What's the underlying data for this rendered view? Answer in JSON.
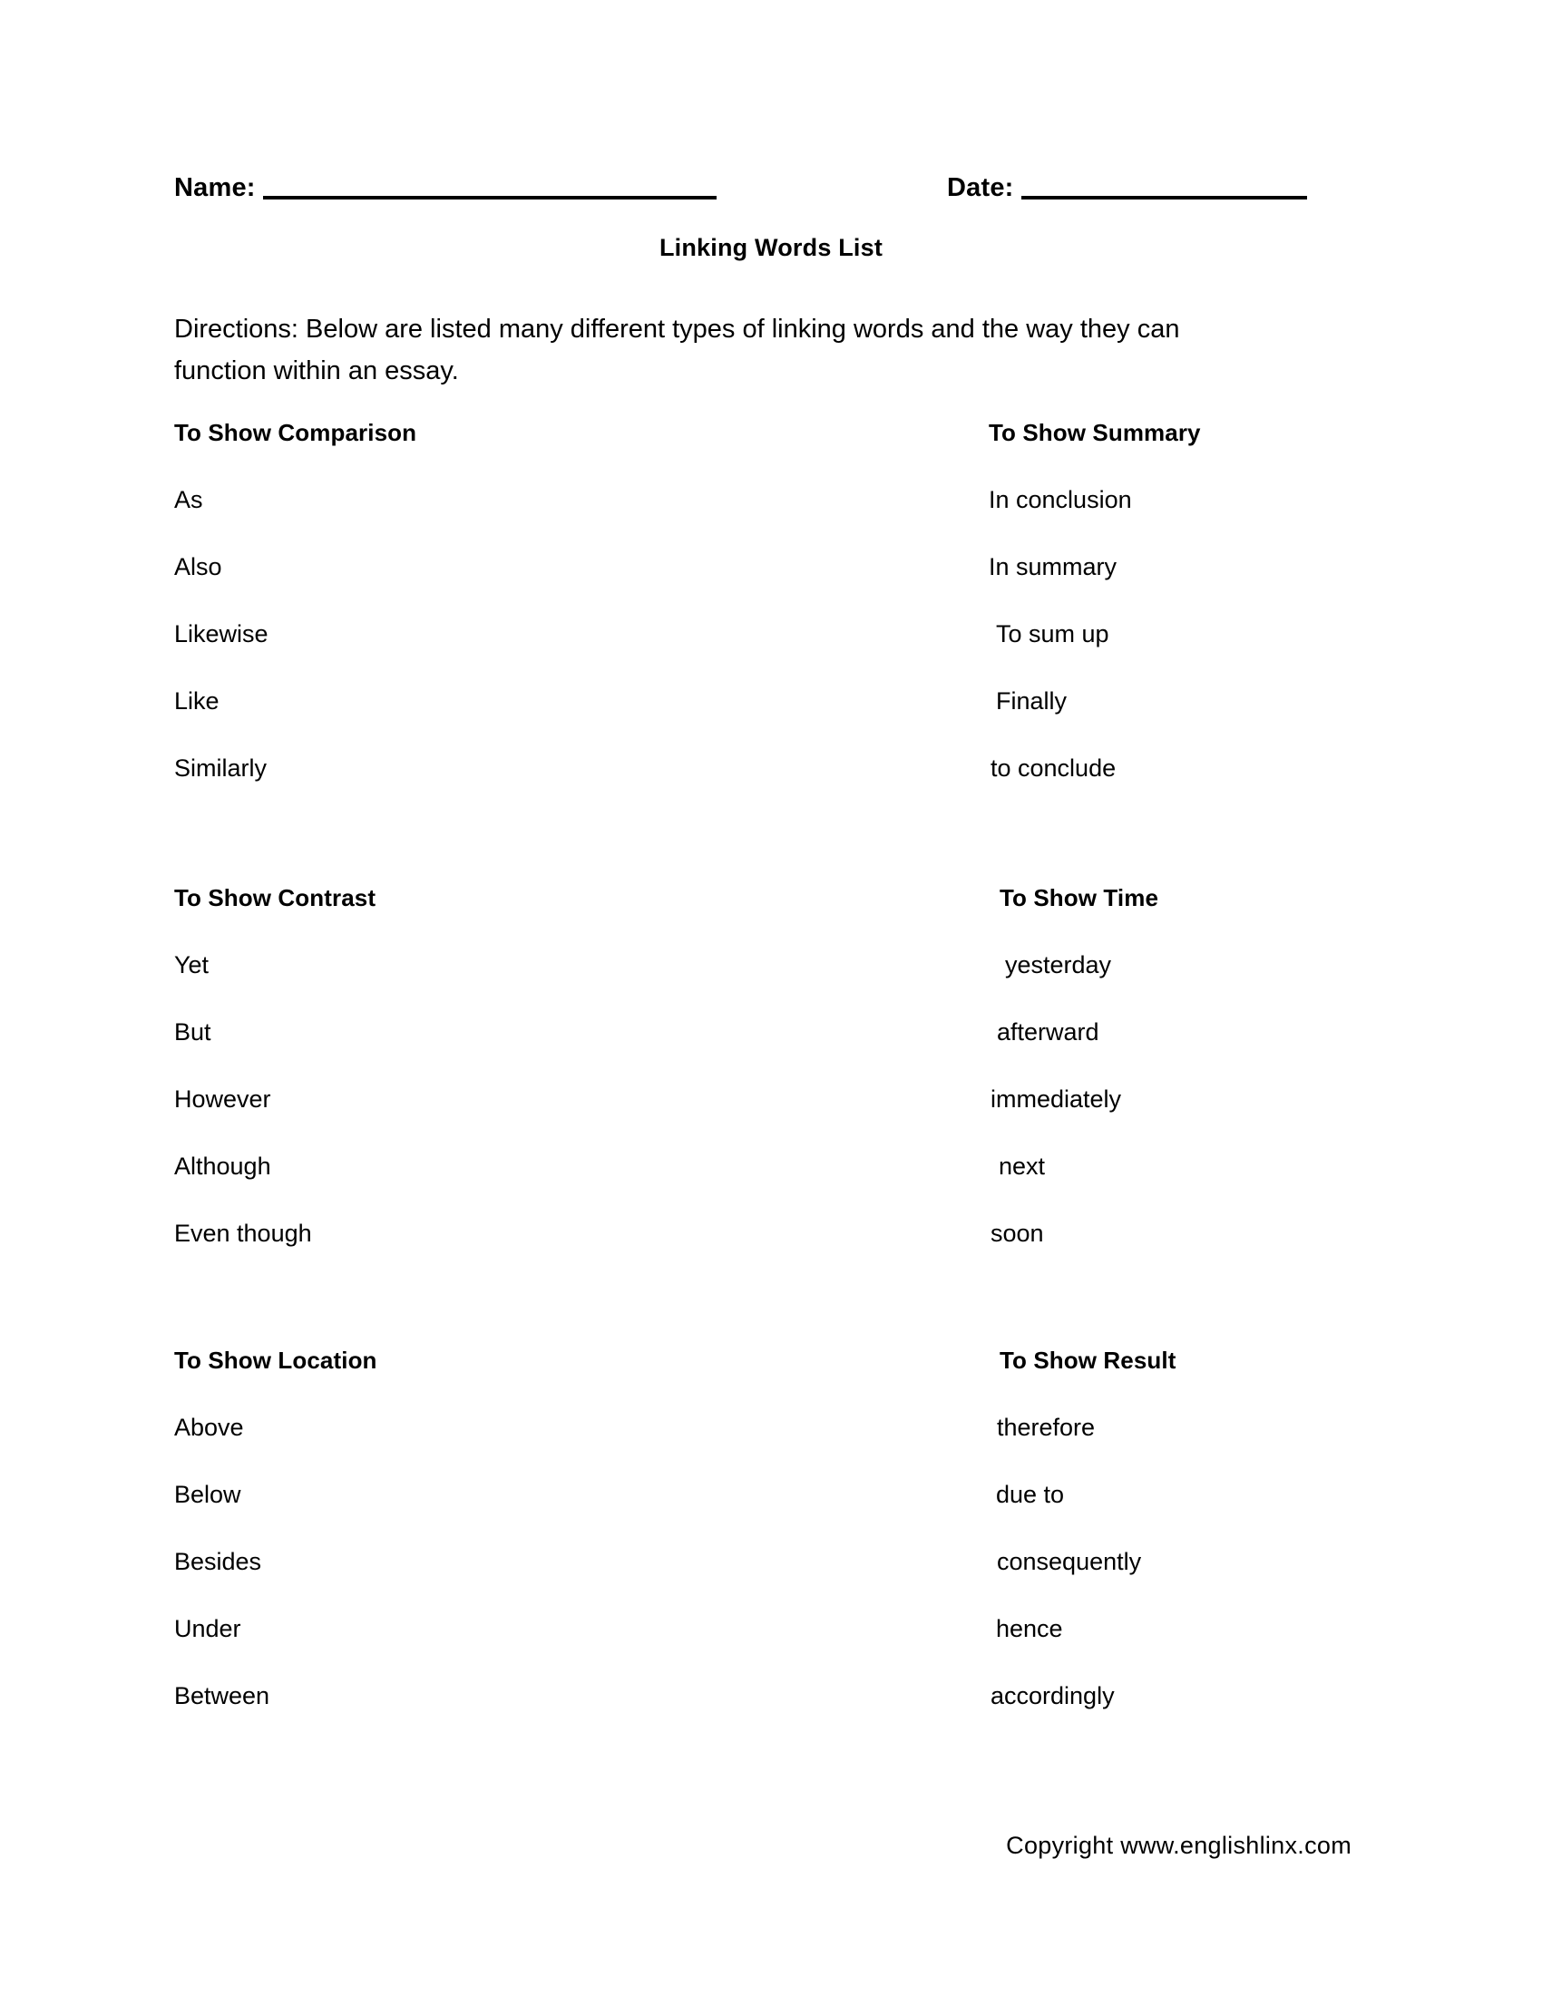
{
  "header": {
    "name_label": "Name:",
    "date_label": "Date:"
  },
  "title": "Linking Words List",
  "directions": "Directions: Below are listed many different types of linking words and the way they can function within an essay.",
  "sections": [
    {
      "left": {
        "heading": "To Show Comparison",
        "items": [
          "As",
          "Also",
          "Likewise",
          "Like",
          "Similarly"
        ]
      },
      "right": {
        "heading": "To Show Summary",
        "items": [
          "In conclusion",
          "In summary",
          "To sum up",
          "Finally",
          "to conclude"
        ]
      }
    },
    {
      "left": {
        "heading": "To Show Contrast",
        "items": [
          "Yet",
          "But",
          "However",
          "Although",
          "Even though"
        ]
      },
      "right": {
        "heading": "To Show Time",
        "items": [
          "yesterday",
          "afterward",
          "immediately",
          "next",
          "soon"
        ]
      }
    },
    {
      "left": {
        "heading": "To Show Location",
        "items": [
          "Above",
          "Below",
          "Besides",
          "Under",
          "Between"
        ]
      },
      "right": {
        "heading": "To Show Result",
        "items": [
          "therefore",
          "due to",
          "consequently",
          "hence",
          "accordingly"
        ]
      }
    }
  ],
  "footer": {
    "copyright": "Copyright www.englishlinx.com"
  }
}
